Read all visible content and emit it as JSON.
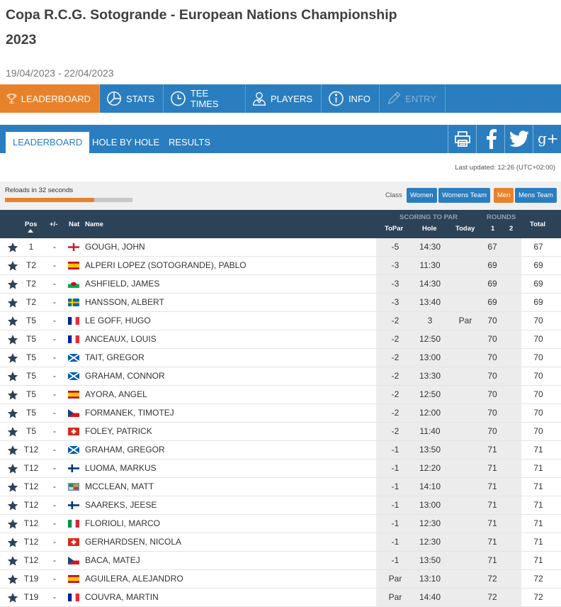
{
  "page": {
    "title": "Copa R.C.G. Sotogrande - European Nations Championship 2023",
    "dates": "19/04/2023 - 22/04/2023"
  },
  "main_nav": [
    {
      "label": "LEADERBOARD",
      "icon": "trophy-icon",
      "active": true
    },
    {
      "label": "STATS",
      "icon": "pie-chart-icon"
    },
    {
      "label": "TEE TIMES",
      "icon": "clock-icon"
    },
    {
      "label": "PLAYERS",
      "icon": "player-icon"
    },
    {
      "label": "INFO",
      "icon": "info-icon"
    },
    {
      "label": "ENTRY",
      "icon": "pencil-icon",
      "disabled": true
    }
  ],
  "sub_nav": {
    "tabs": [
      "LEADERBOARD",
      "HOLE BY HOLE",
      "RESULTS"
    ],
    "social_icons": [
      "print-icon",
      "facebook-icon",
      "twitter-icon",
      "google-plus-icon"
    ]
  },
  "status": {
    "last_updated": "Last updated: 12:26 (UTC+02:00)",
    "reload_text": "Reloads in 32 seconds",
    "reload_progress": 0.7
  },
  "class_filter": {
    "label": "Class",
    "options": [
      "Women",
      "Womens Team",
      "Men",
      "Mens Team"
    ],
    "selected": "Men"
  },
  "table": {
    "headers": {
      "pos": "Pos",
      "change": "+/-",
      "nat": "Nat",
      "name": "Name",
      "scoring_group": "SCORING TO PAR",
      "topar": "ToPar",
      "hole": "Hole",
      "today": "Today",
      "rounds_group": "ROUNDS",
      "r1": "1",
      "r2": "2",
      "total": "Total"
    },
    "rows": [
      {
        "pos": "1",
        "change": "-",
        "nat": "eng",
        "name": "GOUGH, JOHN",
        "topar": "-5",
        "hole": "14:30",
        "today": "",
        "r1": "67",
        "r2": "",
        "total": "67"
      },
      {
        "pos": "T2",
        "change": "-",
        "nat": "esp",
        "name": "ALPERI LOPEZ (SOTOGRANDE), PABLO",
        "topar": "-3",
        "hole": "11:30",
        "today": "",
        "r1": "69",
        "r2": "",
        "total": "69"
      },
      {
        "pos": "T2",
        "change": "-",
        "nat": "wal",
        "name": "ASHFIELD, JAMES",
        "topar": "-3",
        "hole": "14:30",
        "today": "",
        "r1": "69",
        "r2": "",
        "total": "69"
      },
      {
        "pos": "T2",
        "change": "-",
        "nat": "swe",
        "name": "HANSSON, ALBERT",
        "topar": "-3",
        "hole": "13:40",
        "today": "",
        "r1": "69",
        "r2": "",
        "total": "69"
      },
      {
        "pos": "T5",
        "change": "-",
        "nat": "fra",
        "name": "LE GOFF, HUGO",
        "topar": "-2",
        "hole": "3",
        "today": "Par",
        "r1": "70",
        "r2": "",
        "total": "70"
      },
      {
        "pos": "T5",
        "change": "-",
        "nat": "fra",
        "name": "ANCEAUX, LOUIS",
        "topar": "-2",
        "hole": "12:50",
        "today": "",
        "r1": "70",
        "r2": "",
        "total": "70"
      },
      {
        "pos": "T5",
        "change": "-",
        "nat": "sco",
        "name": "TAIT, GREGOR",
        "topar": "-2",
        "hole": "13:00",
        "today": "",
        "r1": "70",
        "r2": "",
        "total": "70"
      },
      {
        "pos": "T5",
        "change": "-",
        "nat": "sco",
        "name": "GRAHAM, CONNOR",
        "topar": "-2",
        "hole": "13:30",
        "today": "",
        "r1": "70",
        "r2": "",
        "total": "70"
      },
      {
        "pos": "T5",
        "change": "-",
        "nat": "esp",
        "name": "AYORA, ANGEL",
        "topar": "-2",
        "hole": "12:50",
        "today": "",
        "r1": "70",
        "r2": "",
        "total": "70"
      },
      {
        "pos": "T5",
        "change": "-",
        "nat": "cze",
        "name": "FORMANEK, TIMOTEJ",
        "topar": "-2",
        "hole": "12:00",
        "today": "",
        "r1": "70",
        "r2": "",
        "total": "70"
      },
      {
        "pos": "T5",
        "change": "-",
        "nat": "sui",
        "name": "FOLEY, PATRICK",
        "topar": "-2",
        "hole": "11:40",
        "today": "",
        "r1": "70",
        "r2": "",
        "total": "70"
      },
      {
        "pos": "T12",
        "change": "-",
        "nat": "sco",
        "name": "GRAHAM, GREGOR",
        "topar": "-1",
        "hole": "13:50",
        "today": "",
        "r1": "71",
        "r2": "",
        "total": "71"
      },
      {
        "pos": "T12",
        "change": "-",
        "nat": "fin",
        "name": "LUOMA, MARKUS",
        "topar": "-1",
        "hole": "12:20",
        "today": "",
        "r1": "71",
        "r2": "",
        "total": "71"
      },
      {
        "pos": "T12",
        "change": "-",
        "nat": "irl",
        "name": "MCCLEAN, MATT",
        "topar": "-1",
        "hole": "14:10",
        "today": "",
        "r1": "71",
        "r2": "",
        "total": "71"
      },
      {
        "pos": "T12",
        "change": "-",
        "nat": "fin",
        "name": "SAAREKS, JEESE",
        "topar": "-1",
        "hole": "13:00",
        "today": "",
        "r1": "71",
        "r2": "",
        "total": "71"
      },
      {
        "pos": "T12",
        "change": "-",
        "nat": "ita",
        "name": "FLORIOLI, MARCO",
        "topar": "-1",
        "hole": "12:30",
        "today": "",
        "r1": "71",
        "r2": "",
        "total": "71"
      },
      {
        "pos": "T12",
        "change": "-",
        "nat": "sui",
        "name": "GERHARDSEN, NICOLA",
        "topar": "-1",
        "hole": "12:30",
        "today": "",
        "r1": "71",
        "r2": "",
        "total": "71"
      },
      {
        "pos": "T12",
        "change": "-",
        "nat": "cze",
        "name": "BACA, MATEJ",
        "topar": "-1",
        "hole": "13:50",
        "today": "",
        "r1": "71",
        "r2": "",
        "total": "71"
      },
      {
        "pos": "T19",
        "change": "-",
        "nat": "esp",
        "name": "AGUILERA, ALEJANDRO",
        "topar": "Par",
        "hole": "13:10",
        "today": "",
        "r1": "72",
        "r2": "",
        "total": "72"
      },
      {
        "pos": "T19",
        "change": "-",
        "nat": "fra",
        "name": "COUVRA, MARTIN",
        "topar": "Par",
        "hole": "14:40",
        "today": "",
        "r1": "72",
        "r2": "",
        "total": "72"
      }
    ]
  },
  "colors": {
    "primary": "#2a7ebf",
    "accent": "#e8822a",
    "header": "#2c4257",
    "score_bg": "#ececec"
  }
}
